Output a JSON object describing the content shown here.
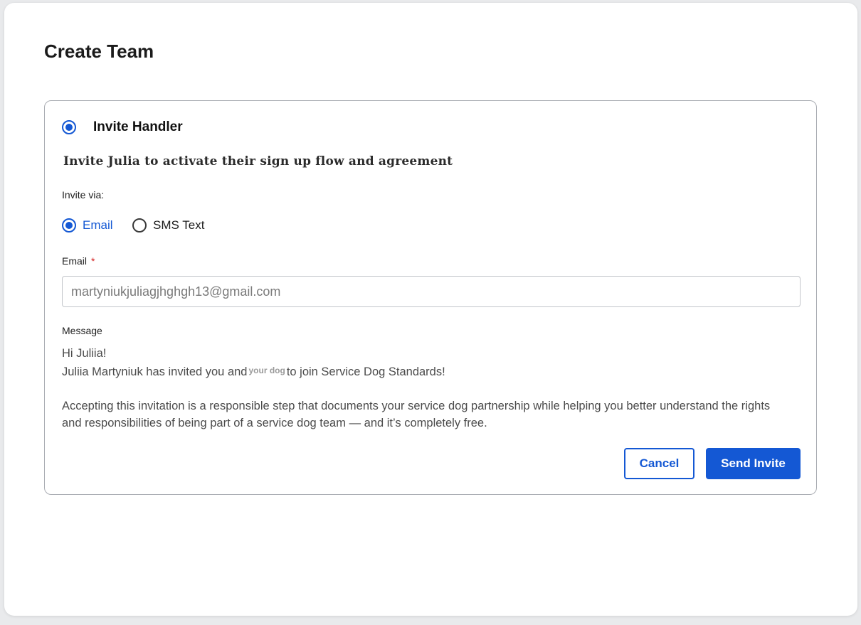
{
  "modal": {
    "title": "Create Team"
  },
  "invite_section": {
    "label": "Invite Handler",
    "selected": true,
    "heading": "Invite Julia to activate their sign up flow and agreement",
    "invite_via_label": "Invite via:",
    "options": [
      {
        "label": "Email",
        "selected": true
      },
      {
        "label": "SMS Text",
        "selected": false
      }
    ],
    "email": {
      "label": "Email",
      "required_marker": "*",
      "value": "martyniukjuliagjhghgh13@gmail.com"
    },
    "message": {
      "label": "Message",
      "greeting": "Hi Juliia!",
      "line_before_chip": "Juliia Martyniuk has invited you and",
      "chip": "your dog",
      "line_after_chip": "to join Service Dog Standards!",
      "paragraph": "Accepting this invitation is a responsible step that documents your service dog partnership while helping you better understand the rights and responsibilities of being part of a service dog team — and it’s completely free."
    }
  },
  "actions": {
    "cancel": "Cancel",
    "send": "Send Invite"
  },
  "colors": {
    "accent": "#1458d4",
    "required": "#d42323",
    "border": "#a9acb2"
  }
}
